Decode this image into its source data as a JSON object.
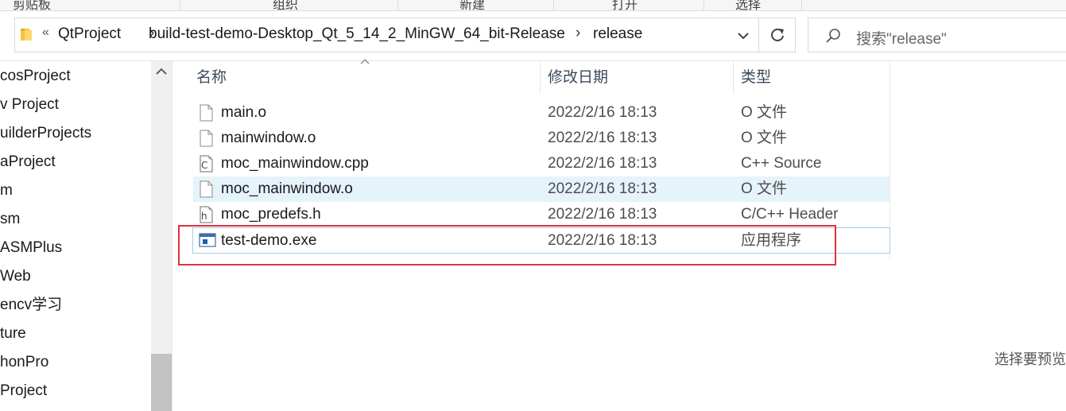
{
  "ribbon": {
    "groups": [
      "剪贴板",
      "组织",
      "新建",
      "打开",
      "选择"
    ]
  },
  "address": {
    "crumbs": [
      "QtProject",
      "build-test-demo-Desktop_Qt_5_14_2_MinGW_64_bit-Release",
      "release"
    ],
    "overflow_glyph": "«",
    "separator_glyph": "›"
  },
  "search": {
    "placeholder": "搜索\"release\""
  },
  "nav": {
    "items": [
      "cosProject",
      "v Project",
      "uilderProjects",
      "aProject",
      "m",
      "sm",
      "ASMPlus",
      "Web",
      "encv学习",
      "ture",
      "honPro",
      "Project"
    ]
  },
  "columns": {
    "name": "名称",
    "date": "修改日期",
    "type": "类型"
  },
  "files": [
    {
      "name": "main.o",
      "date": "2022/2/16 18:13",
      "type": "O 文件",
      "icon": "blank-file-icon"
    },
    {
      "name": "mainwindow.o",
      "date": "2022/2/16 18:13",
      "type": "O 文件",
      "icon": "blank-file-icon"
    },
    {
      "name": "moc_mainwindow.cpp",
      "date": "2022/2/16 18:13",
      "type": "C++ Source",
      "icon": "cpp-file-icon"
    },
    {
      "name": "moc_mainwindow.o",
      "date": "2022/2/16 18:13",
      "type": "O 文件",
      "icon": "blank-file-icon"
    },
    {
      "name": "moc_predefs.h",
      "date": "2022/2/16 18:13",
      "type": "C/C++ Header",
      "icon": "header-file-icon"
    },
    {
      "name": "test-demo.exe",
      "date": "2022/2/16 18:13",
      "type": "应用程序",
      "icon": "exe-app-icon"
    }
  ],
  "preview": {
    "text": "选择要预览"
  },
  "colors": {
    "hover_row": "#e5f3fb",
    "selected_border": "#a9cbe8",
    "annotation_red": "#e0323a"
  }
}
